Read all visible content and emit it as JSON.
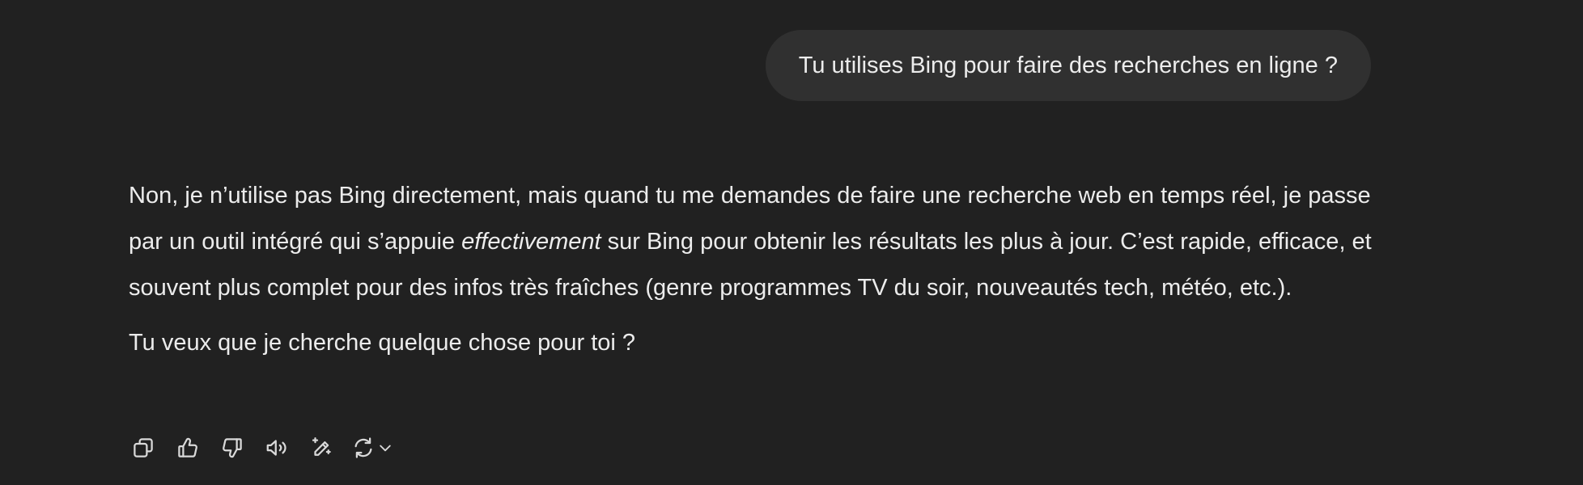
{
  "conversation": {
    "user_message": "Tu utilises Bing pour faire des recherches en ligne ?",
    "assistant": {
      "paragraph1_start": "Non, je n’utilise pas Bing directement, mais quand tu me demandes de faire une recherche web en temps réel, je passe par un outil intégré qui s’appuie ",
      "paragraph1_emphasis": "effectivement",
      "paragraph1_end": " sur Bing pour obtenir les résultats les plus à jour. C’est rapide, efficace, et souvent plus complet pour des infos très fraîches (genre programmes TV du soir, nouveautés tech, météo, etc.).",
      "paragraph2": "Tu veux que je cherche quelque chose pour toi ?"
    }
  },
  "action_icons": [
    "copy-icon",
    "thumbs-up-icon",
    "thumbs-down-icon",
    "read-aloud-icon",
    "edit-sparkle-icon",
    "regenerate-icon",
    "chevron-down-icon"
  ]
}
